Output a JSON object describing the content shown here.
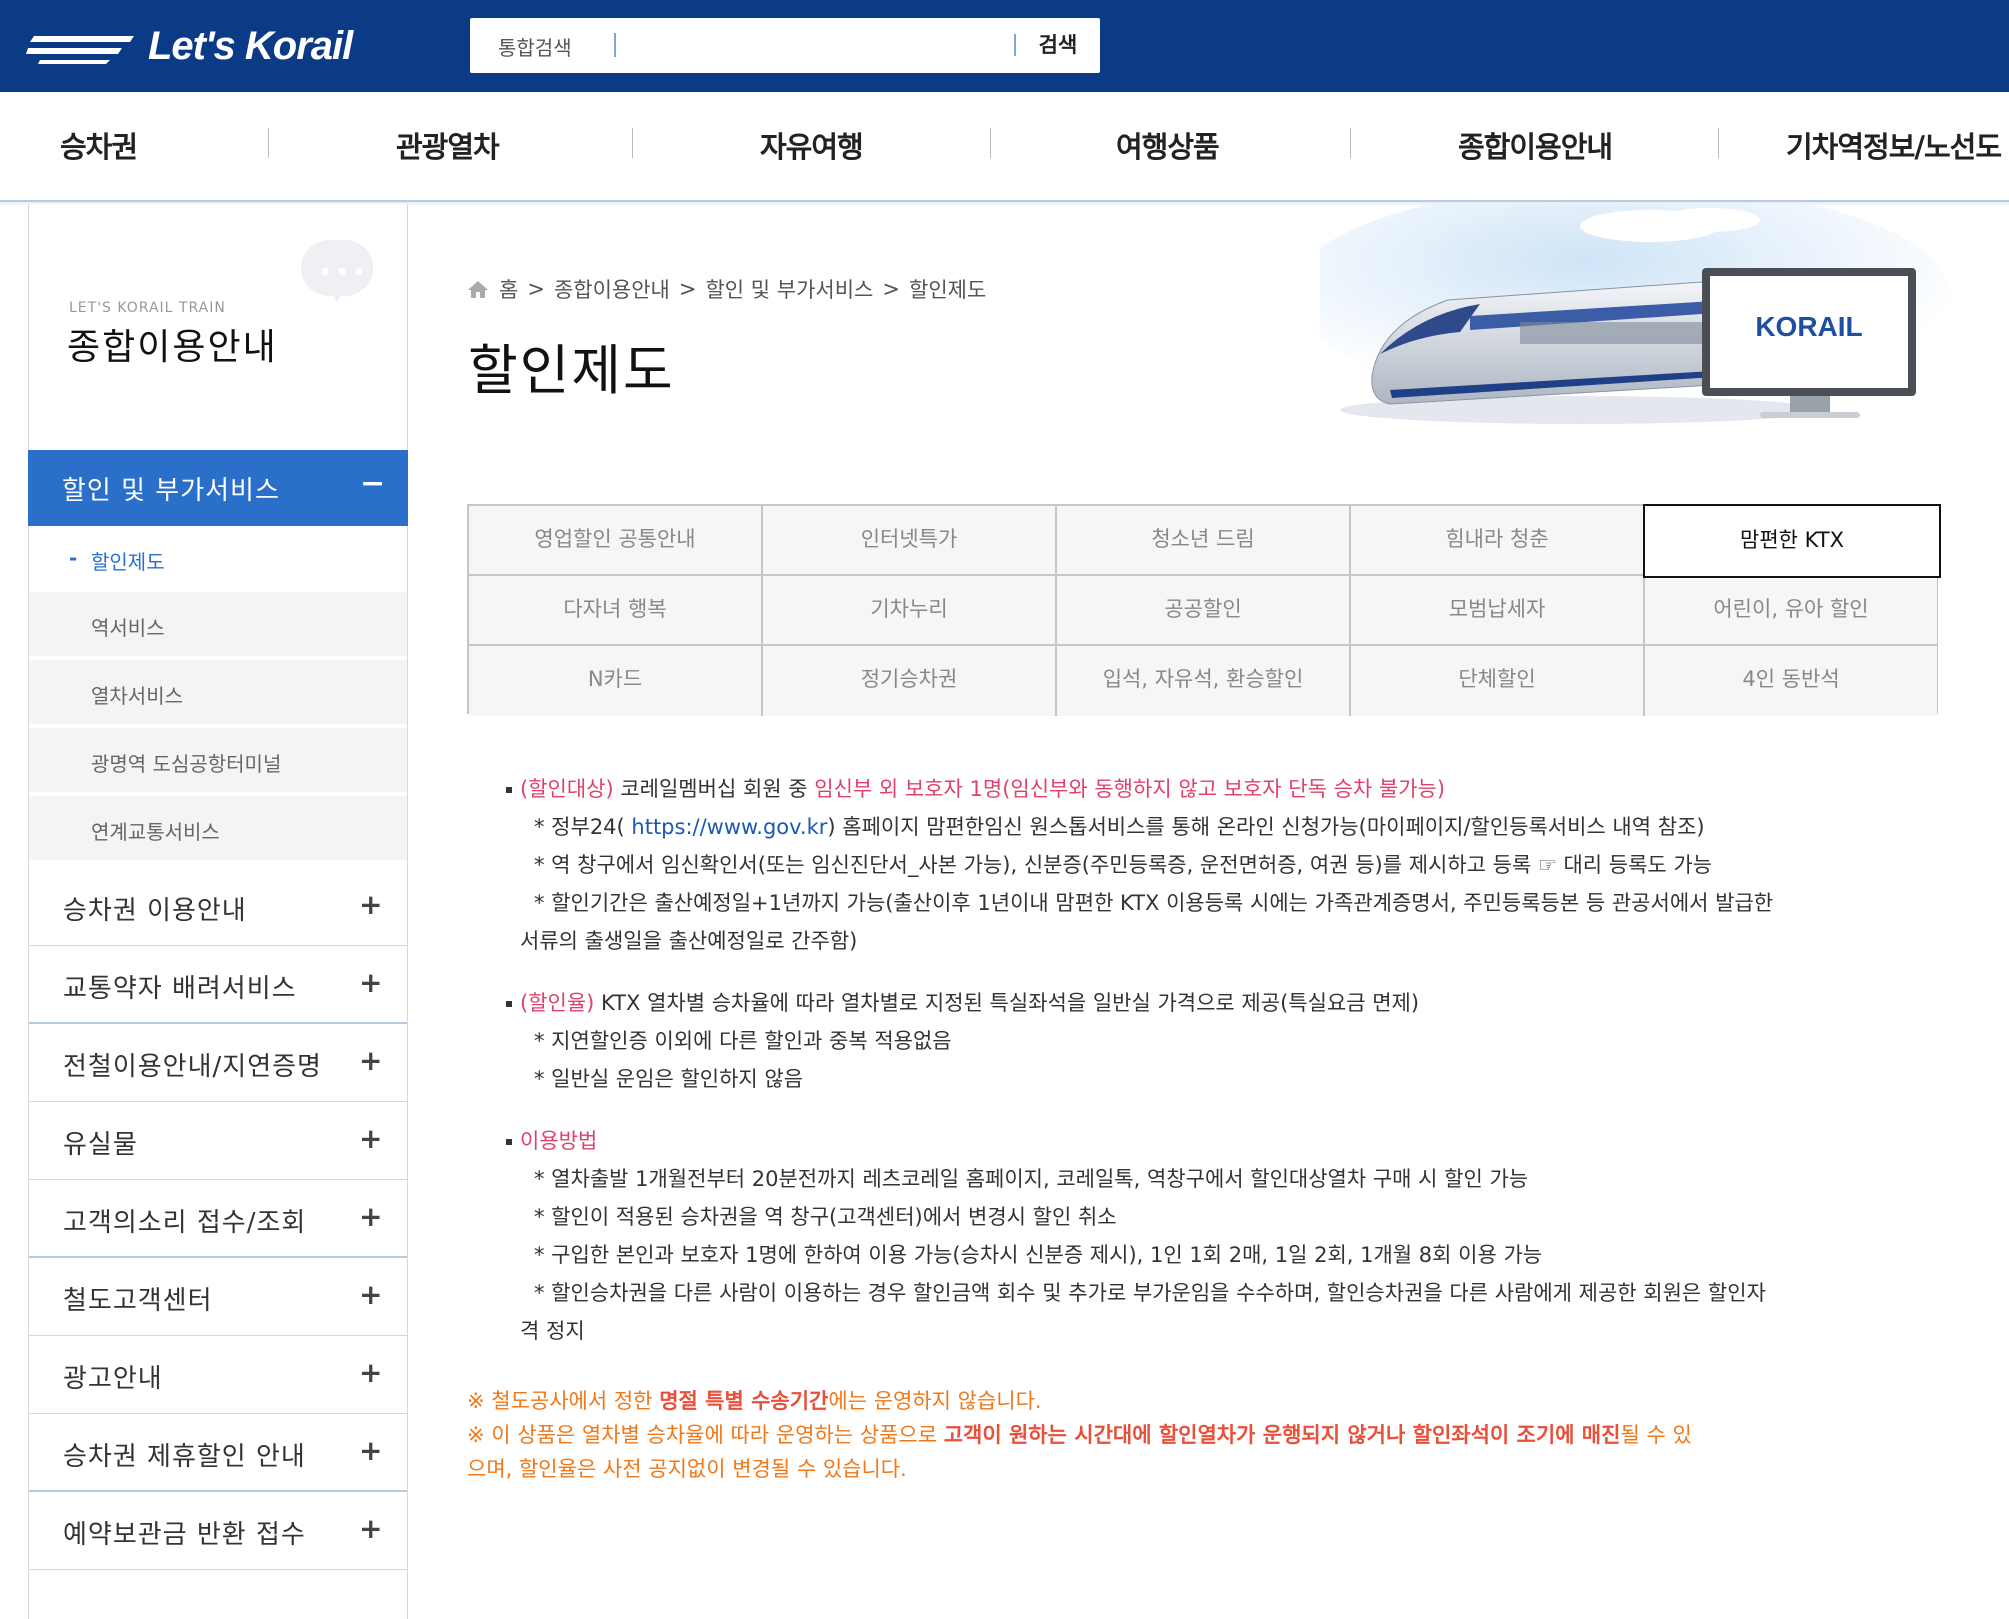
{
  "header": {
    "logo_text": "Let's Korail",
    "search_placeholder": "통합검색",
    "search_button": "검색"
  },
  "gnb": [
    "승차권",
    "관광열차",
    "자유여행",
    "여행상품",
    "종합이용안내",
    "기차역정보/노선도"
  ],
  "sidebar": {
    "subtitle": "LET'S KORAIL TRAIN",
    "title": "종합이용안내",
    "active_section": "할인 및 부가서비스",
    "active_symbol": "−",
    "sub_items": [
      "할인제도",
      "역서비스",
      "열차서비스",
      "광명역 도심공항터미널",
      "연계교통서비스"
    ],
    "sub_dash": "-",
    "menus": [
      "승차권 이용안내",
      "교통약자 배려서비스",
      "전철이용안내/지연증명",
      "유실물",
      "고객의소리 접수/조회",
      "철도고객센터",
      "광고안내",
      "승차권 제휴할인 안내",
      "예약보관금 반환 접수"
    ],
    "plus_symbol": "+"
  },
  "breadcrumb": [
    "홈",
    "종합이용안내",
    "할인 및 부가서비스",
    "할인제도"
  ],
  "breadcrumb_sep": ">",
  "page_title": "할인제도",
  "banner": {
    "monitor_text": "KORAIL"
  },
  "tabs": [
    [
      "영업할인 공통안내",
      "인터넷특가",
      "청소년 드림",
      "힘내라 청춘",
      "맘편한 KTX"
    ],
    [
      "다자녀 행복",
      "기차누리",
      "공공할인",
      "모범납세자",
      "어린이, 유아 할인"
    ],
    [
      "N카드",
      "정기승차권",
      "입석, 자유석, 환승할인",
      "단체할인",
      "4인 동반석"
    ]
  ],
  "active_tab": "맘편한 KTX",
  "sections": [
    {
      "label": "(할인대상)",
      "text": " 코레일멤버십 회원 중 ",
      "highlight": "임신부 외 보호자 1명(임신부와 동행하지 않고 보호자 단독 승차 불가능)",
      "items": [
        {
          "pre": "* 정부24( ",
          "link": "https://www.gov.kr",
          "post": ") 홈페이지 맘편한임신 원스톱서비스를 통해 온라인 신청가능(마이페이지/할인등록서비스 내역 참조)"
        },
        {
          "pre": "* 역 창구에서 임신확인서(또는 임신진단서_사본 가능), 신분증(주민등록증, 운전면허증, 여권 등)를 제시하고 등록 ☞ 대리 등록도 가능"
        },
        {
          "pre": "* 할인기간은 출산예정일+1년까지 가능(출산이후 1년이내 맘편한 KTX 이용등록 시에는 가족관계증명서, 주민등록등본 등 관공서에서 발급한"
        },
        {
          "cont": "서류의 출생일을 출산예정일로 간주함)"
        }
      ]
    },
    {
      "label": "(할인율)",
      "text": " KTX 열차별 승차율에 따라 열차별로 지정된 특실좌석을 일반실 가격으로 제공(특실요금 면제)",
      "items": [
        {
          "pre": "* 지연할인증 이외에 다른 할인과 중복 적용없음"
        },
        {
          "pre": "* 일반실 운임은 할인하지 않음"
        }
      ]
    },
    {
      "label": "이용방법",
      "text": "",
      "items": [
        {
          "pre": "* 열차출발 1개월전부터 20분전까지 레츠코레일 홈페이지, 코레일톡, 역창구에서 할인대상열차 구매 시 할인 가능"
        },
        {
          "pre": "* 할인이 적용된 승차권을 역 창구(고객센터)에서 변경시 할인 취소"
        },
        {
          "pre": "* 구입한 본인과 보호자 1명에 한하여 이용 가능(승차시 신분증 제시), 1인 1회 2매, 1일 2회, 1개월 8회 이용 가능"
        },
        {
          "pre": "* 할인승차권을 다른 사람이 이용하는 경우 할인금액 회수 및 추가로 부가운임을 수수하며, 할인승차권을 다른 사람에게 제공한 회원은 할인자"
        },
        {
          "cont": "격 정지"
        }
      ]
    }
  ],
  "notes": {
    "n1_pre": "※ 철도공사에서 정한 ",
    "n1_bold": "명절 특별 수송기간",
    "n1_post": "에는 운영하지 않습니다.",
    "n2_pre": "※ 이 상품은 열차별 승차율에 따라 운영하는 상품으로 ",
    "n2_bold": "고객이 원하는 시간대에 할인열차가 운행되지 않거나 할인좌석이 조기에 매진",
    "n2_post": "될 수 있",
    "n2_cont": "으며, 할인율은 사전 공지없이 변경될 수 있습니다."
  },
  "colors": {
    "header_blue": "#0b3a86",
    "active_blue": "#2a6fc9",
    "pink": "#e0416b",
    "orange": "#f07818"
  }
}
